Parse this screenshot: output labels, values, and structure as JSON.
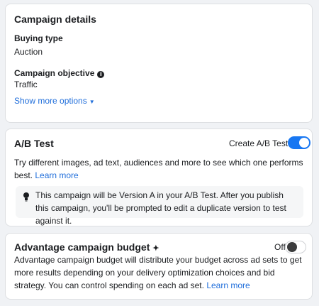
{
  "campaign_details": {
    "title": "Campaign details",
    "buying_type_label": "Buying type",
    "buying_type_value": "Auction",
    "objective_label": "Campaign objective",
    "objective_value": "Traffic",
    "show_more": "Show more options"
  },
  "ab_test": {
    "title": "A/B Test",
    "toggle_label": "Create A/B Test",
    "toggle_on": true,
    "description": "Try different images, ad text, audiences and more to see which one performs best.",
    "learn_more": "Learn more",
    "note": "This campaign will be Version A in your A/B Test. After you publish this campaign, you'll be prompted to edit a duplicate version to test against it."
  },
  "budget": {
    "title": "Advantage campaign budget",
    "sparkle": "✦",
    "toggle_label": "Off",
    "toggle_on": false,
    "description": "Advantage campaign budget will distribute your budget across ad sets to get more results depending on your delivery optimization choices and bid strategy. You can control spending on each ad set.",
    "learn_more": "Learn more"
  },
  "colors": {
    "accent": "#1877f2",
    "link": "#216fdb"
  }
}
